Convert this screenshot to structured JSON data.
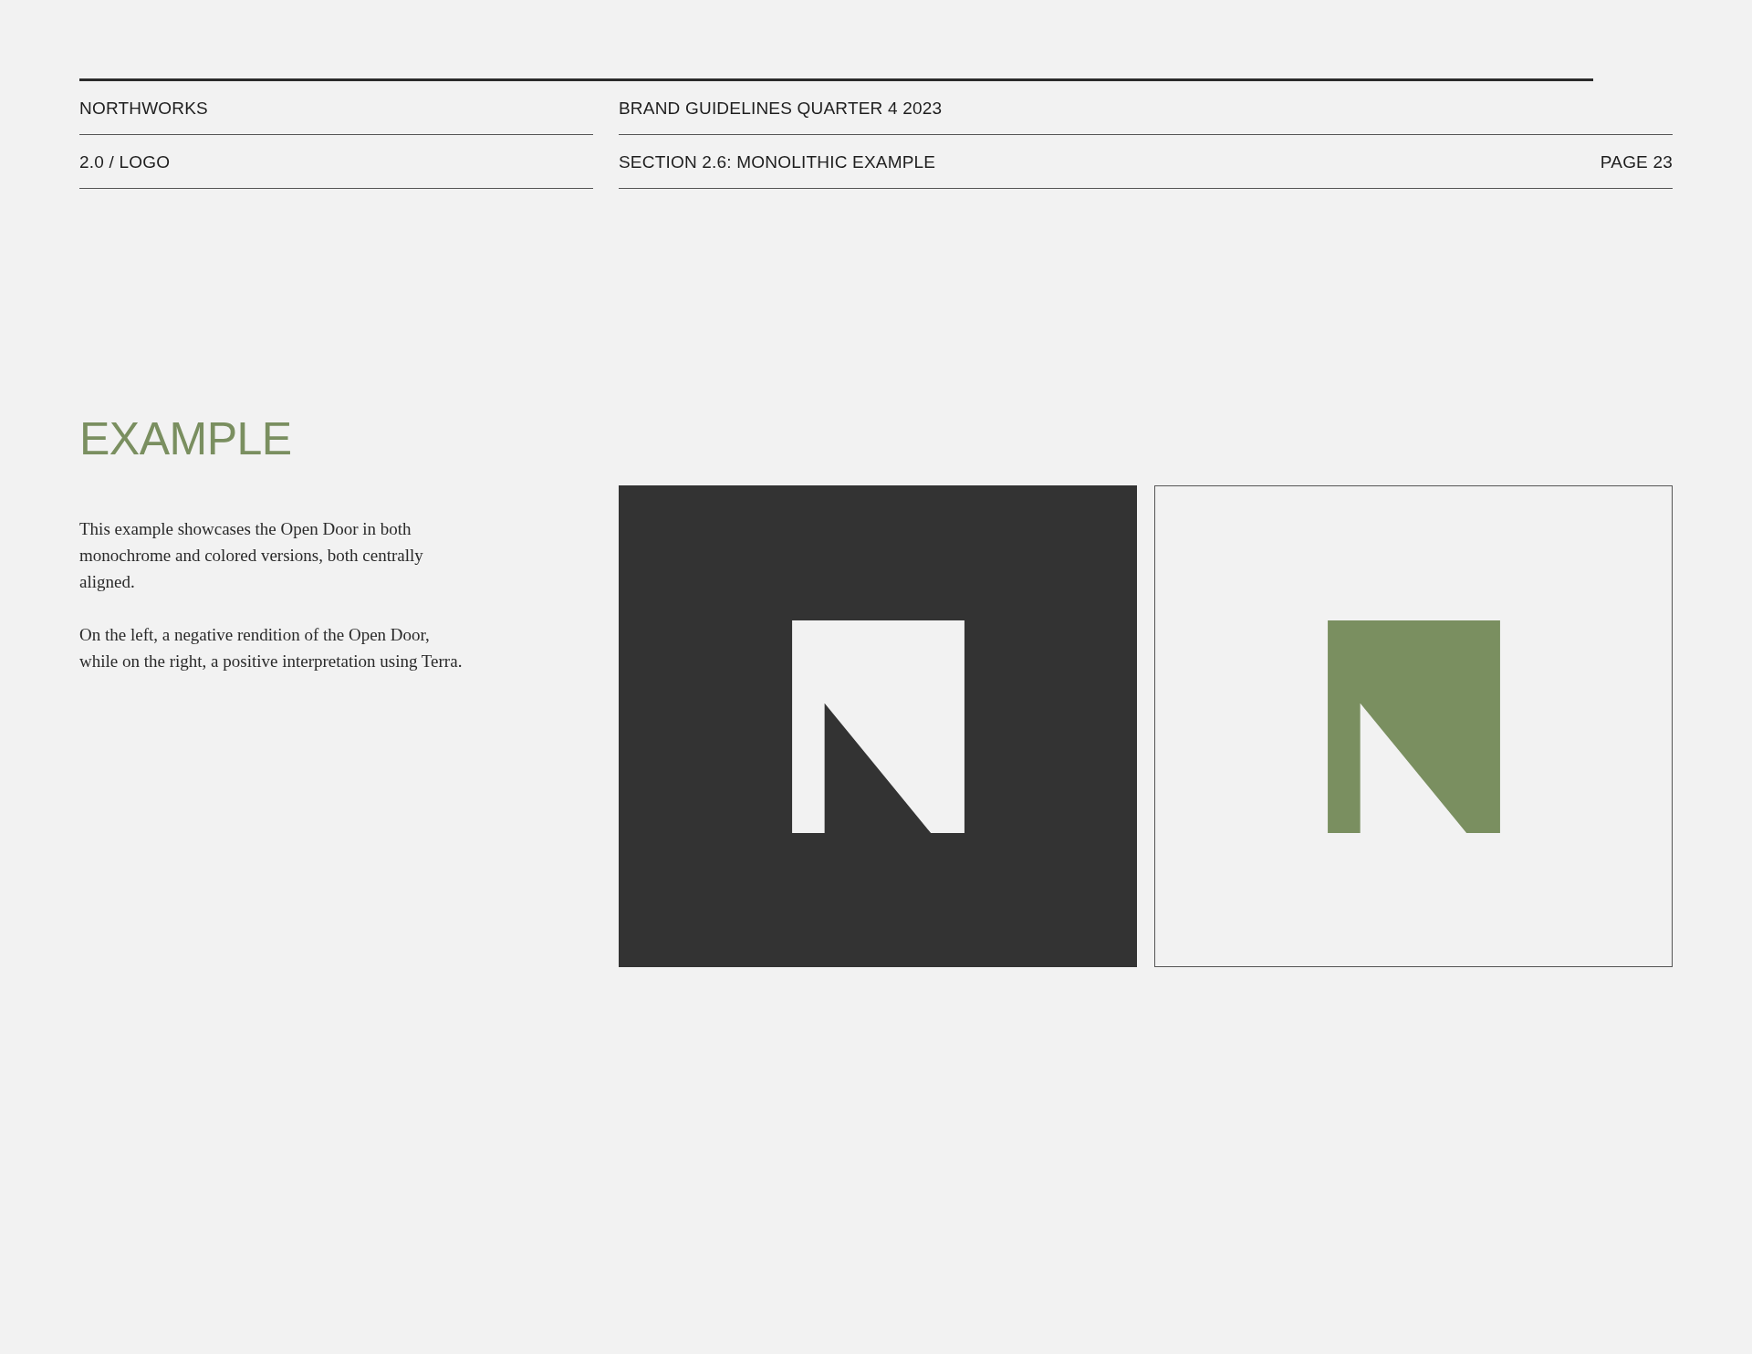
{
  "header": {
    "brand": "NORTHWORKS",
    "document_title": "BRAND GUIDELINES QUARTER 4 2023",
    "section_number": "2.0 / LOGO",
    "section_title": "SECTION 2.6: MONOLITHIC EXAMPLE",
    "page": "PAGE 23"
  },
  "example": {
    "heading": "EXAMPLE",
    "paragraphs": [
      "This example showcases the Open Door in both monochrome and colored versions, both centrally aligned.",
      "On the left, a negative rendition of the Open Door, while on the right, a positive interpretation using Terra."
    ]
  },
  "panels": [
    {
      "kind": "negative"
    },
    {
      "kind": "positive"
    }
  ]
}
